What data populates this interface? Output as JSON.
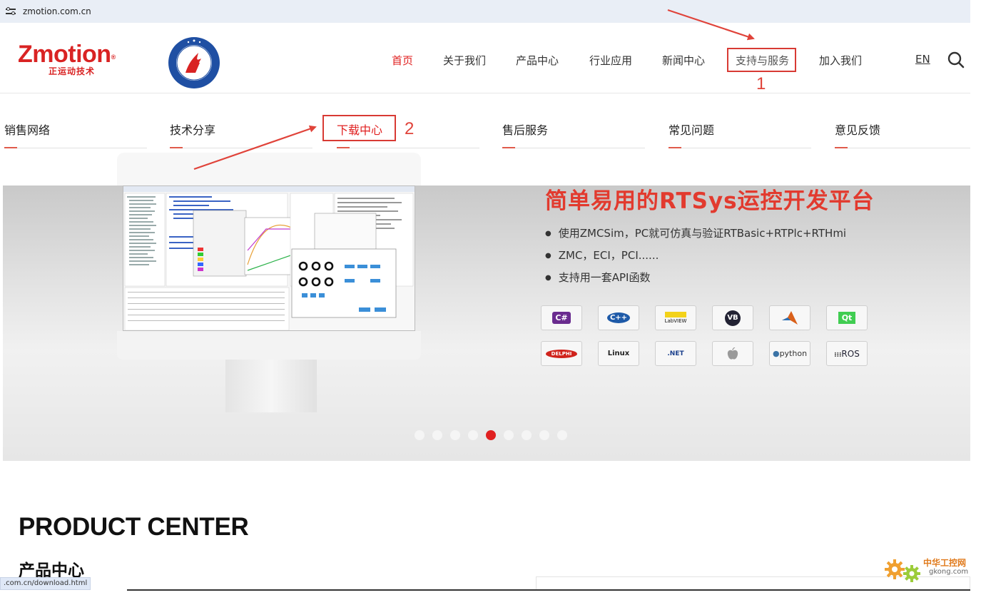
{
  "browser": {
    "url": "zmotion.com.cn",
    "status_url": ".com.cn/download.html"
  },
  "logo": {
    "word": "Zmotion",
    "reg": "®",
    "tagline": "正运动技术"
  },
  "nav": {
    "items": [
      "首页",
      "关于我们",
      "产品中心",
      "行业应用",
      "新闻中心",
      "支持与服务",
      "加入我们"
    ],
    "active_index": 0,
    "lang": "EN",
    "annotation": "1"
  },
  "submenu": {
    "items": [
      "销售网络",
      "技术分享",
      "下载中心",
      "售后服务",
      "常见问题",
      "意见反馈"
    ],
    "annotation": "2"
  },
  "banner": {
    "title": "简单易用的RTSys运控开发平台",
    "bullets": [
      "使用ZMCSim，PC就可仿真与验证RTBasic+RTPlc+RTHmi",
      "ZMC，ECI，PCI......",
      "支持用一套API函数"
    ],
    "platforms": [
      "C#",
      "C++",
      "LabVIEW",
      "VB",
      "MATLAB",
      "Qt",
      "DELPHI",
      "Linux",
      ".NET",
      "Apple",
      "python",
      "ROS"
    ],
    "slide_count": 9,
    "active_slide": 4
  },
  "product": {
    "title_en": "PRODUCT CENTER",
    "title_cn": "产品中心"
  },
  "watermark": {
    "name": "中华工控网",
    "domain": "gkong.com"
  },
  "colors": {
    "brand": "#d92323",
    "annotation": "#d83a34"
  }
}
